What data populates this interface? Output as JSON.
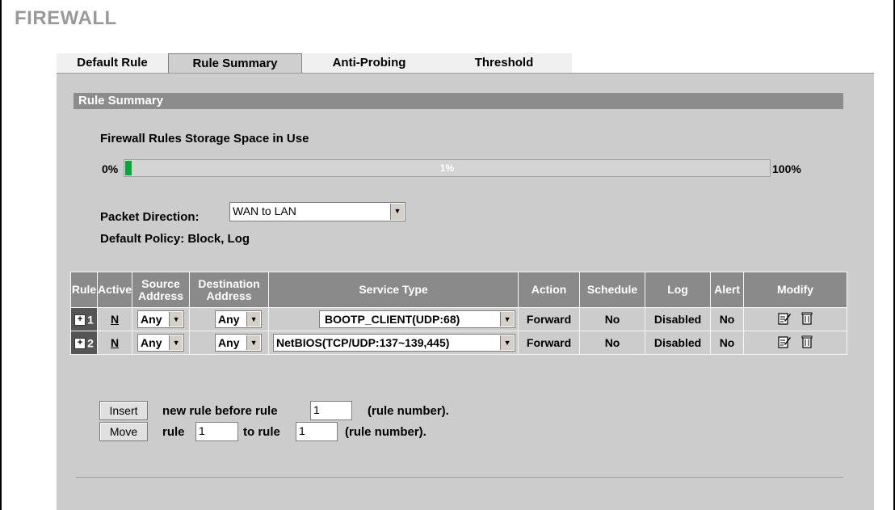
{
  "page": {
    "title": "FIREWALL"
  },
  "tabs": [
    {
      "label": "Default Rule"
    },
    {
      "label": "Rule Summary"
    },
    {
      "label": "Anti-Probing"
    },
    {
      "label": "Threshold"
    }
  ],
  "section": {
    "title": "Rule Summary"
  },
  "storage": {
    "title": "Firewall Rules Storage Space in Use",
    "min_label": "0%",
    "max_label": "100%",
    "percent_label": "1%",
    "percent_value": 0.01,
    "fill_color": "#00a83a"
  },
  "direction": {
    "label": "Packet Direction:",
    "value": "WAN to LAN"
  },
  "policy": {
    "text": "Default Policy: Block, Log"
  },
  "table": {
    "headers": {
      "rule": "Rule",
      "active": "Active",
      "source_line1": "Source",
      "source_line2": "Address",
      "dest_line1": "Destination",
      "dest_line2": "Address",
      "service": "Service Type",
      "action": "Action",
      "schedule": "Schedule",
      "log": "Log",
      "alert": "Alert",
      "modify": "Modify"
    },
    "rows": [
      {
        "number": "1",
        "active": "N",
        "source": "Any",
        "destination": "Any",
        "service": "BOOTP_CLIENT(UDP:68)",
        "action": "Forward",
        "schedule": "No",
        "log": "Disabled",
        "alert": "No",
        "expand_icon": "plus-box-icon",
        "edit_icon": "edit-icon",
        "delete_icon": "trash-icon"
      },
      {
        "number": "2",
        "active": "N",
        "source": "Any",
        "destination": "Any",
        "service": "NetBIOS(TCP/UDP:137~139,445)",
        "action": "Forward",
        "schedule": "No",
        "log": "Disabled",
        "alert": "No",
        "expand_icon": "plus-box-icon",
        "edit_icon": "edit-icon",
        "delete_icon": "trash-icon"
      }
    ]
  },
  "insert": {
    "button": "Insert",
    "text": "new rule before rule",
    "value": "1",
    "suffix": "(rule number)."
  },
  "move": {
    "button": "Move",
    "text_rule": "rule",
    "value_from": "1",
    "text_to": "to rule",
    "value_to": "1",
    "suffix": "(rule number)."
  },
  "colors": {
    "panel_bg": "#cccccc",
    "header_bg": "#8a8a8a",
    "section_bg": "#8c8c8c",
    "title_color": "#9a9a9a"
  }
}
